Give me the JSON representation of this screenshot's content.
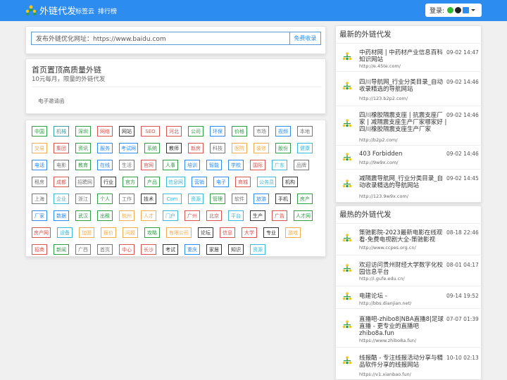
{
  "header": {
    "brand": "外链代发",
    "nav": [
      "标签云",
      "排行榜"
    ],
    "login_label": "登录:"
  },
  "search": {
    "placeholder": "发布外链优化网址：https://www.baidu.com",
    "button": "免费收录"
  },
  "promo": {
    "title": "首页置顶高质量外链",
    "subtitle": "10元每月，限量的外链代发",
    "link": "电子邀请函"
  },
  "tags": [
    {
      "t": "中国",
      "c": "#2e9e44"
    },
    {
      "t": "机械",
      "c": "#3a9d9f"
    },
    {
      "t": "深圳",
      "c": "#2e9e44"
    },
    {
      "t": "网络",
      "c": "#d9534f"
    },
    {
      "t": "网站",
      "c": "#333333"
    },
    {
      "t": "SEO",
      "c": "#d9534f"
    },
    {
      "t": "河北",
      "c": "#d9534f"
    },
    {
      "t": "公司",
      "c": "#2e9e44"
    },
    {
      "t": "环保",
      "c": "#2d8cf0"
    },
    {
      "t": "价格",
      "c": "#2e9e44"
    },
    {
      "t": "市场",
      "c": "#777777"
    },
    {
      "t": "视频",
      "c": "#2d8cf0"
    },
    {
      "t": "本地",
      "c": "#777777"
    },
    {
      "t": "交易",
      "c": "#f0ad4e"
    },
    {
      "t": "集团",
      "c": "#d9534f"
    },
    {
      "t": "资讯",
      "c": "#2e9e44"
    },
    {
      "t": "服务",
      "c": "#2d8cf0"
    },
    {
      "t": "考试网",
      "c": "#2d8cf0"
    },
    {
      "t": "系统",
      "c": "#2e9e44"
    },
    {
      "t": "教师",
      "c": "#333333"
    },
    {
      "t": "新房",
      "c": "#d9534f"
    },
    {
      "t": "科技",
      "c": "#777777"
    },
    {
      "t": "医院",
      "c": "#f0ad4e"
    },
    {
      "t": "装修",
      "c": "#f0ad4e"
    },
    {
      "t": "股份",
      "c": "#2e9e44"
    },
    {
      "t": "健康",
      "c": "#3ab9d9"
    },
    {
      "t": "电话",
      "c": "#2d8cf0"
    },
    {
      "t": "电影",
      "c": "#777777"
    },
    {
      "t": "教育",
      "c": "#2e9e44"
    },
    {
      "t": "在线",
      "c": "#2d8cf0"
    },
    {
      "t": "生活",
      "c": "#777777"
    },
    {
      "t": "官网",
      "c": "#d9534f"
    },
    {
      "t": "人事",
      "c": "#2e9e44"
    },
    {
      "t": "培训",
      "c": "#2d8cf0"
    },
    {
      "t": "智能",
      "c": "#2d8cf0"
    },
    {
      "t": "学校",
      "c": "#2d8cf0"
    },
    {
      "t": "国际",
      "c": "#d9534f"
    },
    {
      "t": "广东",
      "c": "#3ab9d9"
    },
    {
      "t": "品牌",
      "c": "#777777"
    },
    {
      "t": "租房",
      "c": "#777777"
    },
    {
      "t": "成都",
      "c": "#d9534f"
    },
    {
      "t": "招聘网",
      "c": "#777777"
    },
    {
      "t": "行业",
      "c": "#333333"
    },
    {
      "t": "官方",
      "c": "#2e9e44"
    },
    {
      "t": "产品",
      "c": "#2e9e44"
    },
    {
      "t": "信息网",
      "c": "#3ab9d9"
    },
    {
      "t": "营销",
      "c": "#2d8cf0"
    },
    {
      "t": "电子",
      "c": "#2d8cf0"
    },
    {
      "t": "商城",
      "c": "#d9534f"
    },
    {
      "t": "公务员",
      "c": "#3ab9d9"
    },
    {
      "t": "机构",
      "c": "#333333"
    },
    {
      "t": "上海",
      "c": "#777777"
    },
    {
      "t": "企业",
      "c": "#3ab9d9"
    },
    {
      "t": "浙江",
      "c": "#777777"
    },
    {
      "t": "个人",
      "c": "#2e9e44"
    },
    {
      "t": "工作",
      "c": "#777777"
    },
    {
      "t": "技术",
      "c": "#333333"
    },
    {
      "t": "Com",
      "c": "#3ab9d9"
    },
    {
      "t": "资源",
      "c": "#3ab9d9"
    },
    {
      "t": "管理",
      "c": "#2e9e44"
    },
    {
      "t": "软件",
      "c": "#777777"
    },
    {
      "t": "旅游",
      "c": "#2d8cf0"
    },
    {
      "t": "手机",
      "c": "#333333"
    },
    {
      "t": "房产",
      "c": "#2e9e44"
    },
    {
      "t": "厂家",
      "c": "#2d8cf0"
    },
    {
      "t": "数据",
      "c": "#2d8cf0"
    },
    {
      "t": "武汉",
      "c": "#2e9e44"
    },
    {
      "t": "出租",
      "c": "#2e9e44"
    },
    {
      "t": "杭州",
      "c": "#f0ad4e"
    },
    {
      "t": "人才",
      "c": "#f0ad4e"
    },
    {
      "t": "门户",
      "c": "#3ab9d9"
    },
    {
      "t": "广州",
      "c": "#d9534f"
    },
    {
      "t": "北京",
      "c": "#d9534f"
    },
    {
      "t": "平台",
      "c": "#3ab9d9"
    },
    {
      "t": "生产",
      "c": "#333333"
    },
    {
      "t": "广告",
      "c": "#d9534f"
    },
    {
      "t": "人才网",
      "c": "#2e9e44"
    },
    {
      "t": "房产网",
      "c": "#d9534f"
    },
    {
      "t": "设备",
      "c": "#3ab9d9"
    },
    {
      "t": "加盟",
      "c": "#f0ad4e"
    },
    {
      "t": "报价",
      "c": "#f0ad4e"
    },
    {
      "t": "问题",
      "c": "#f0ad4e"
    },
    {
      "t": "攻略",
      "c": "#2e9e44"
    },
    {
      "t": "有限公司",
      "c": "#f0ad4e"
    },
    {
      "t": "论坛",
      "c": "#333333"
    },
    {
      "t": "信息",
      "c": "#d9534f"
    },
    {
      "t": "大学",
      "c": "#d9534f"
    },
    {
      "t": "专业",
      "c": "#333333"
    },
    {
      "t": "游戏",
      "c": "#f0ad4e"
    },
    {
      "t": "招商",
      "c": "#d9534f"
    },
    {
      "t": "新闻",
      "c": "#2e9e44"
    },
    {
      "t": "广西",
      "c": "#777777"
    },
    {
      "t": "首页",
      "c": "#777777"
    },
    {
      "t": "中心",
      "c": "#d9534f"
    },
    {
      "t": "长沙",
      "c": "#d9534f"
    },
    {
      "t": "考试",
      "c": "#333333"
    },
    {
      "t": "重庆",
      "c": "#2d8cf0"
    },
    {
      "t": "家居",
      "c": "#333333"
    },
    {
      "t": "知识",
      "c": "#333333"
    },
    {
      "t": "资源",
      "c": "#3ab9d9"
    }
  ],
  "latest": {
    "heading": "最新的外链代发",
    "items": [
      {
        "title": "中药材网 | 中药材产业信息百科知识网站",
        "date": "09-02 14:47",
        "url": "http://e.45te.com/"
      },
      {
        "title": "四川导航网_行业分类目录_自动收录精选的导航网站",
        "date": "09-02 14:46",
        "url": "http://123.b2p2.com/"
      },
      {
        "title": "四川橡胶隔震支座 | 抗震支座厂家 | 减隔震支座生产厂家哪家好 | 四川橡胶隔震支座生产厂家",
        "date": "09-02 14:46",
        "url": "http://b2p2.com/"
      },
      {
        "title": "403 Forbidden",
        "date": "09-02 14:46",
        "url": "http://9w9x.com/"
      },
      {
        "title": "减隔震导航网_行业分类目录_自动收录精选的导航网站",
        "date": "09-02 14:45",
        "url": "http://123.9w9x.com/"
      }
    ]
  },
  "hottest": {
    "heading": "最热的外链代发",
    "items": [
      {
        "title": "策驰影院-2023最新电影在线观看-免费电视剧大全-策驰影视",
        "date": "08-18 22:46",
        "url": "http://www.ccpes.org.cn/"
      },
      {
        "title": "欢迎访问贵州财经大学数字化校园信息平台",
        "date": "08-01 04:17",
        "url": "http://i.gufe.edu.cn/"
      },
      {
        "title": "电建论坛 -",
        "date": "09-14 19:52",
        "url": "http://bbs.dianjian.net/"
      },
      {
        "title": "直播吧-zhibo8|NBA直播8|足球直播 - 更专业的直播吧 zhibo8a.fun",
        "date": "07-07 01:39",
        "url": "https://www.zhibo8a.fun/"
      },
      {
        "title": "线报酷 - 专注线报活动分享与精品软件分享的线报网站",
        "date": "10-10 02:13",
        "url": "https://v1.xianbao.fun/"
      }
    ]
  }
}
